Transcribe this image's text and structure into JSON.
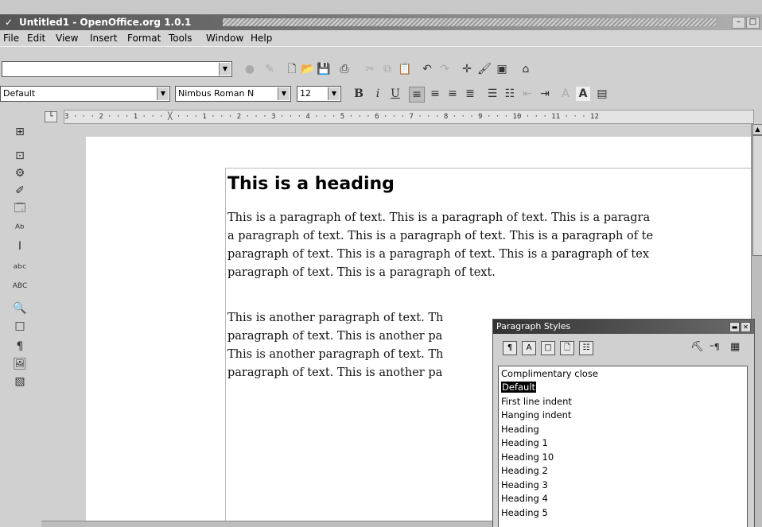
{
  "window": {
    "title": "Untitled1 - OpenOffice.org 1.0.1",
    "minimize": "–",
    "maximize": "□"
  },
  "menubar": [
    "File",
    "Edit",
    "View",
    "Insert",
    "Format",
    "Tools",
    "Window",
    "Help"
  ],
  "toolbar": {
    "url_value": "",
    "style_value": "Default",
    "font_value": "Nimbus Roman N",
    "size_value": "12",
    "bold": "B",
    "italic": "i",
    "underline": "U",
    "font_color_a": "A",
    "highlight_a": "A"
  },
  "ruler": "3 · · · 2 · · · 1 · · · ╳ · · · 1 · · · 2 · · · 3 · · · 4 · · · 5 · · · 6 · · · 7 · · · 8 · · · 9 · · · 10 · · · 11 · · · 12",
  "document": {
    "heading": "This is a heading",
    "p1_lines": [
      "This is a paragraph of text. This is a paragraph of text. This is a paragra",
      "a paragraph of text. This is a paragraph of text. This is a paragraph of te",
      "paragraph of text. This is a paragraph of text. This is a paragraph of tex",
      "paragraph of text. This is a paragraph of text."
    ],
    "p2_lines": [
      "This is another paragraph of text. Th",
      "paragraph of text. This is another pa",
      "This is another paragraph of text. Th",
      "paragraph of text. This is another pa"
    ]
  },
  "stylist": {
    "title": "Paragraph Styles",
    "items": [
      "Complimentary close",
      "Default",
      "First line indent",
      "Hanging indent",
      "Heading",
      "Heading 1",
      "Heading 10",
      "Heading 2",
      "Heading 3",
      "Heading 4",
      "Heading 5"
    ],
    "selected": "Default"
  }
}
